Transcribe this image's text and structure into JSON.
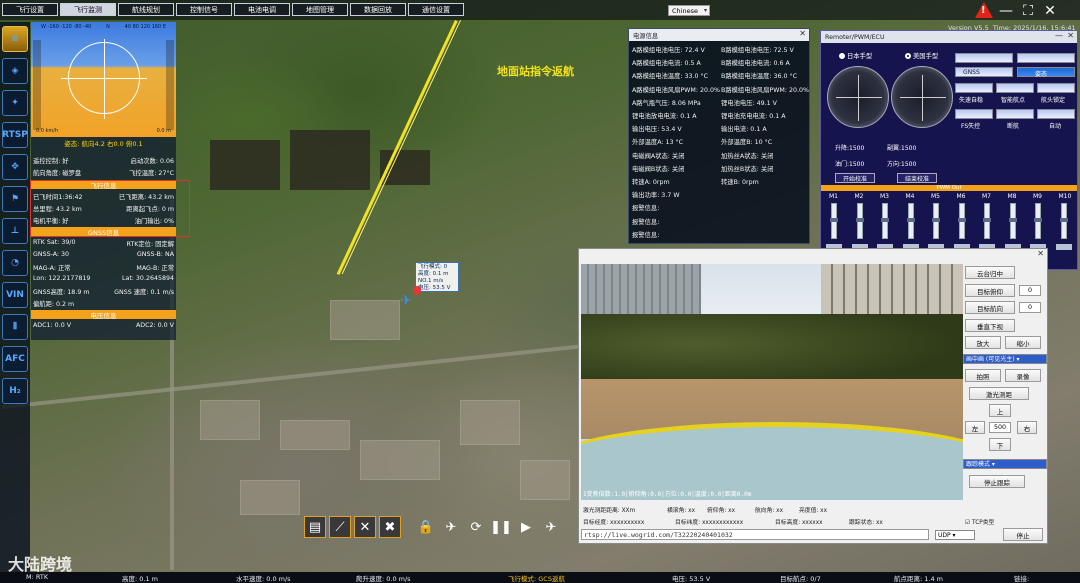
{
  "tabs": [
    "飞行设置",
    "飞行监测",
    "航线规划",
    "控制信号",
    "电池电调",
    "地图管理",
    "数据回放",
    "通信设置"
  ],
  "active_tab": 1,
  "language": "Chinese",
  "version": "Version V5.5",
  "time": "Time: 2025/1/16, 15:6:41",
  "rail_icons": [
    "database-icon",
    "layers-icon",
    "drone-icon",
    "rtsp-icon",
    "quadcopter-icon",
    "flag-icon",
    "landing-icon",
    "gauge-icon",
    "vin-icon",
    "voltage-icon",
    "afc-icon",
    "hydrogen-icon"
  ],
  "rail_labels": {
    "rtsp": "RTSP",
    "vin": "VIN",
    "afc": "AFC",
    "h2": "H₂"
  },
  "attitude": {
    "scale_left": "W  -160 -120 -80  -40",
    "scale_mid": "N",
    "scale_right": "40  80  120 160  E",
    "speed_unit": "0.0 km/h",
    "alt_unit": "0.0 m",
    "readout": "姿态: 航向4.2  右0.0  俯0.1"
  },
  "left_rows": [
    {
      "l": "遥控控制: 好",
      "r": "启动次数: 0.06"
    },
    {
      "l": "航向角度: 磁罗盘",
      "r": "飞控温度: 27°C"
    }
  ],
  "flight_section": "飞行信息",
  "flight_rows": [
    {
      "l": "已飞时间1:36:42",
      "r": "已飞距离: 43.2 km"
    },
    {
      "l": "总里程: 43.2 km",
      "r": "距离起飞点: 0 m"
    },
    {
      "l": "电机平衡: 好",
      "r": "油门输出: 0%"
    }
  ],
  "gnss_section": "GNSS信息",
  "gnss_rows": [
    {
      "l": "RTK Sat: 39/0",
      "r": "RTK定位: 固定解"
    },
    {
      "l": "GNSS-A: 30",
      "r": "GNSS-B: NA"
    },
    {
      "l": "MAG-A: 正常",
      "r": "MAG-B: 正常"
    },
    {
      "l": "Lon: 122.2177819",
      "r": "Lat: 30.2645894"
    },
    {
      "l": "GNSS高度: 18.9 m",
      "r": "GNSS 速度: 0.1 m/s"
    },
    {
      "l": "偏航距: 0.2 m",
      "r": ""
    }
  ],
  "voltage_section": "电压信息",
  "adc": {
    "l": "ADC1: 0.0 V",
    "r": "ADC2: 0.0 V"
  },
  "battery": {
    "title": "电源信息",
    "rows": [
      {
        "l": "A路模组电池电压: 72.4 V",
        "r": "B路模组电池电压: 72.5 V"
      },
      {
        "l": "A路模组电池电流: 0.5 A",
        "r": "B路模组电池电流: 0.6 A"
      },
      {
        "l": "A路模组电池温度: 33.0 °C",
        "r": "B路模组电池温度: 36.0 °C"
      },
      {
        "l": "A路模组电池风扇PWM: 20.0%",
        "r": "B路模组电池风扇PWM: 20.0%"
      },
      {
        "l": "A路气瓶气压: 8.06 MPa",
        "r": "锂电池电压: 49.1 V"
      },
      {
        "l": "锂电池放电电流: 0.1 A",
        "r": "锂电池充电电流: 0.1 A"
      },
      {
        "l": "输出电压: 53.4 V",
        "r": "输出电流: 0.1 A"
      },
      {
        "l": "外部温度A: 13 °C",
        "r": "外部温度B: 10 °C"
      },
      {
        "l": "电磁阀A状态: 关闭",
        "r": "加热丝A状态: 关闭"
      },
      {
        "l": "电磁阀B状态: 关闭",
        "r": "加热丝B状态: 关闭"
      },
      {
        "l": "转速A: 0rpm",
        "r": "转速B: 0rpm"
      },
      {
        "l": "输出功率: 3.7 W",
        "r": ""
      },
      {
        "l": "报警信息:",
        "r": ""
      },
      {
        "l": "报警信息:",
        "r": ""
      },
      {
        "l": "报警信息:",
        "r": ""
      }
    ]
  },
  "remoter": {
    "title": "Remoter/PWM/ECU",
    "mode_jp": "日本手型",
    "mode_us": "美国手型",
    "status_labels": [
      "GNSS",
      "姿态",
      "失速自稳",
      "智能航点",
      "航头锁定",
      "FS失控",
      "断航",
      "自动"
    ],
    "pitch": "升降:1500",
    "roll": "副翼:1500",
    "throttle": "油门:1500",
    "yaw": "方向:1500",
    "btn_start": "开始校准",
    "btn_end": "结束校准",
    "pwm_title": "PWM Out",
    "pwm_channels": [
      "M1",
      "M2",
      "M3",
      "M4",
      "M5",
      "M6",
      "M7",
      "M8",
      "M9",
      "M10"
    ]
  },
  "camera": {
    "osd": "1变焦倍数:1.0|俯仰角:0.0|方位:0.0|温度:0.0|距离0.0m",
    "info": [
      "激光测距距离: XXm",
      "横滚角: xx",
      "俯仰角: xx",
      "航向角: xx",
      "亮度值: xx",
      "目标经度: xxxxxxxxxx",
      "目标纬度: xxxxxxxxxxxx",
      "目标高度: xxxxxx",
      "跟踪状态: xx"
    ],
    "url": "rtsp://live.wogrid.com/T32220240401032",
    "udp": "UDP",
    "tcp_label": "TCP类型",
    "stop": "停止",
    "btn_center": "云台归中",
    "btn_pitch": "目标俯仰",
    "pitch_val": "0",
    "btn_yaw": "目标航向",
    "yaw_val": "0",
    "btn_down": "垂直下视",
    "btn_zoom_in": "放大",
    "btn_zoom_out": "缩小",
    "mode_select": "画中画 (可见光主)",
    "btn_photo": "拍照",
    "btn_record": "录像",
    "btn_laser": "激光测距",
    "btn_up": "上",
    "btn_left": "左",
    "step": "500",
    "btn_right": "右",
    "btn_dn": "下",
    "track_select": "跟踪模式",
    "btn_stop_track": "停止跟踪"
  },
  "map": {
    "rtl_text": "地面站指令返航",
    "drone_box": [
      "飞行模式: 0",
      "高度: 0.1 m",
      "NO.1  m/s",
      "电压: 53.5 V"
    ]
  },
  "toolbar_icons": [
    "mission-icon",
    "ruler-icon",
    "cross-icon",
    "clear-icon",
    "lock-icon",
    "takeoff-icon",
    "loop-icon",
    "pause-icon",
    "play-icon",
    "land-icon"
  ],
  "status": {
    "mode": "M: RTK",
    "alt": "高度: 0.1 m",
    "hspeed": "水平速度: 0.0 m/s",
    "vspeed": "爬升速度: 0.0 m/s",
    "flight_mode": "飞行模式:  GCS返航",
    "volt": "电压: 53.5 V",
    "wp": "目标航点: 0/7",
    "wp_dist": "航点距离: 1.4 m",
    "link": "链接:"
  },
  "watermark": "大陆跨境"
}
